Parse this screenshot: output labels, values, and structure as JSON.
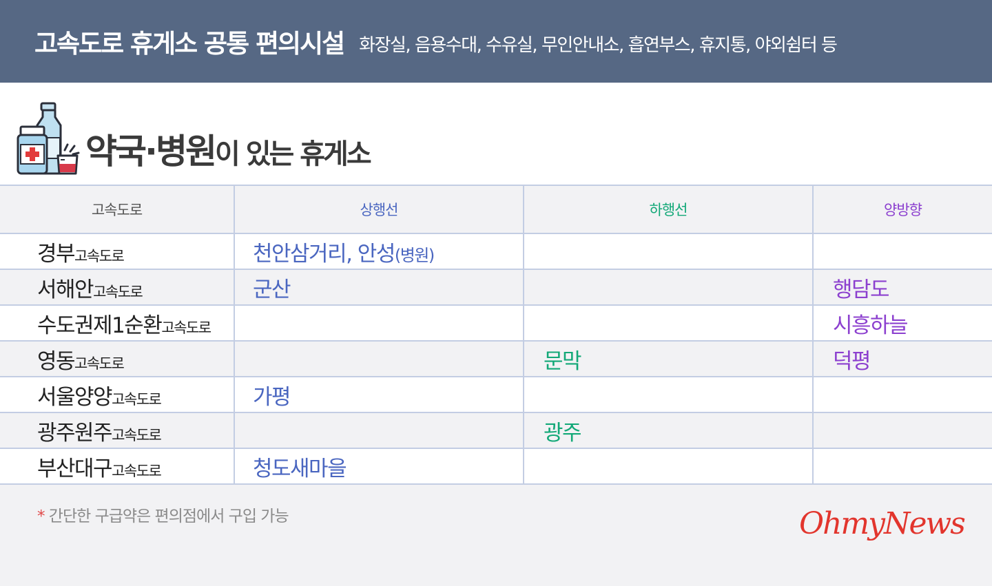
{
  "banner": {
    "title": "고속도로 휴게소 공통 편의시설",
    "subtitle": "화장실, 음용수대, 수유실, 무인안내소, 흡연부스, 휴지통, 야외쉼터 등"
  },
  "heading": {
    "part_big": "약국·병원",
    "part_small": "이 있는 휴게소"
  },
  "table": {
    "headers": {
      "highway": "고속도로",
      "up": "상행선",
      "down": "하행선",
      "both": "양방향"
    },
    "header_colors": {
      "highway": "#555555",
      "up": "#4a66c0",
      "down": "#12a877",
      "both": "#8c40cf"
    },
    "rows": [
      {
        "name": "경부",
        "suffix": "고속도로",
        "up": "천안삼거리, 안성",
        "up_note": "(병원)",
        "down": "",
        "both": ""
      },
      {
        "name": "서해안",
        "suffix": "고속도로",
        "up": "군산",
        "up_note": "",
        "down": "",
        "both": "행담도"
      },
      {
        "name": "수도권제1순환",
        "suffix": "고속도로",
        "up": "",
        "up_note": "",
        "down": "",
        "both": "시흥하늘"
      },
      {
        "name": "영동",
        "suffix": "고속도로",
        "up": "",
        "up_note": "",
        "down": "문막",
        "both": "덕평"
      },
      {
        "name": "서울양양",
        "suffix": "고속도로",
        "up": "가평",
        "up_note": "",
        "down": "",
        "both": ""
      },
      {
        "name": "광주원주",
        "suffix": "고속도로",
        "up": "",
        "up_note": "",
        "down": "광주",
        "both": ""
      },
      {
        "name": "부산대구",
        "suffix": "고속도로",
        "up": "청도새마을",
        "up_note": "",
        "down": "",
        "both": ""
      }
    ]
  },
  "footnote": {
    "star": "*",
    "text": " 간단한 구급약은 편의점에서 구입 가능"
  },
  "logo": "OhmyNews",
  "icons": {
    "pharmacy": "medicine-bottles-icon"
  },
  "colors": {
    "banner_bg": "#566884",
    "grid_line": "#c3cde3",
    "logo": "#e2352d"
  }
}
